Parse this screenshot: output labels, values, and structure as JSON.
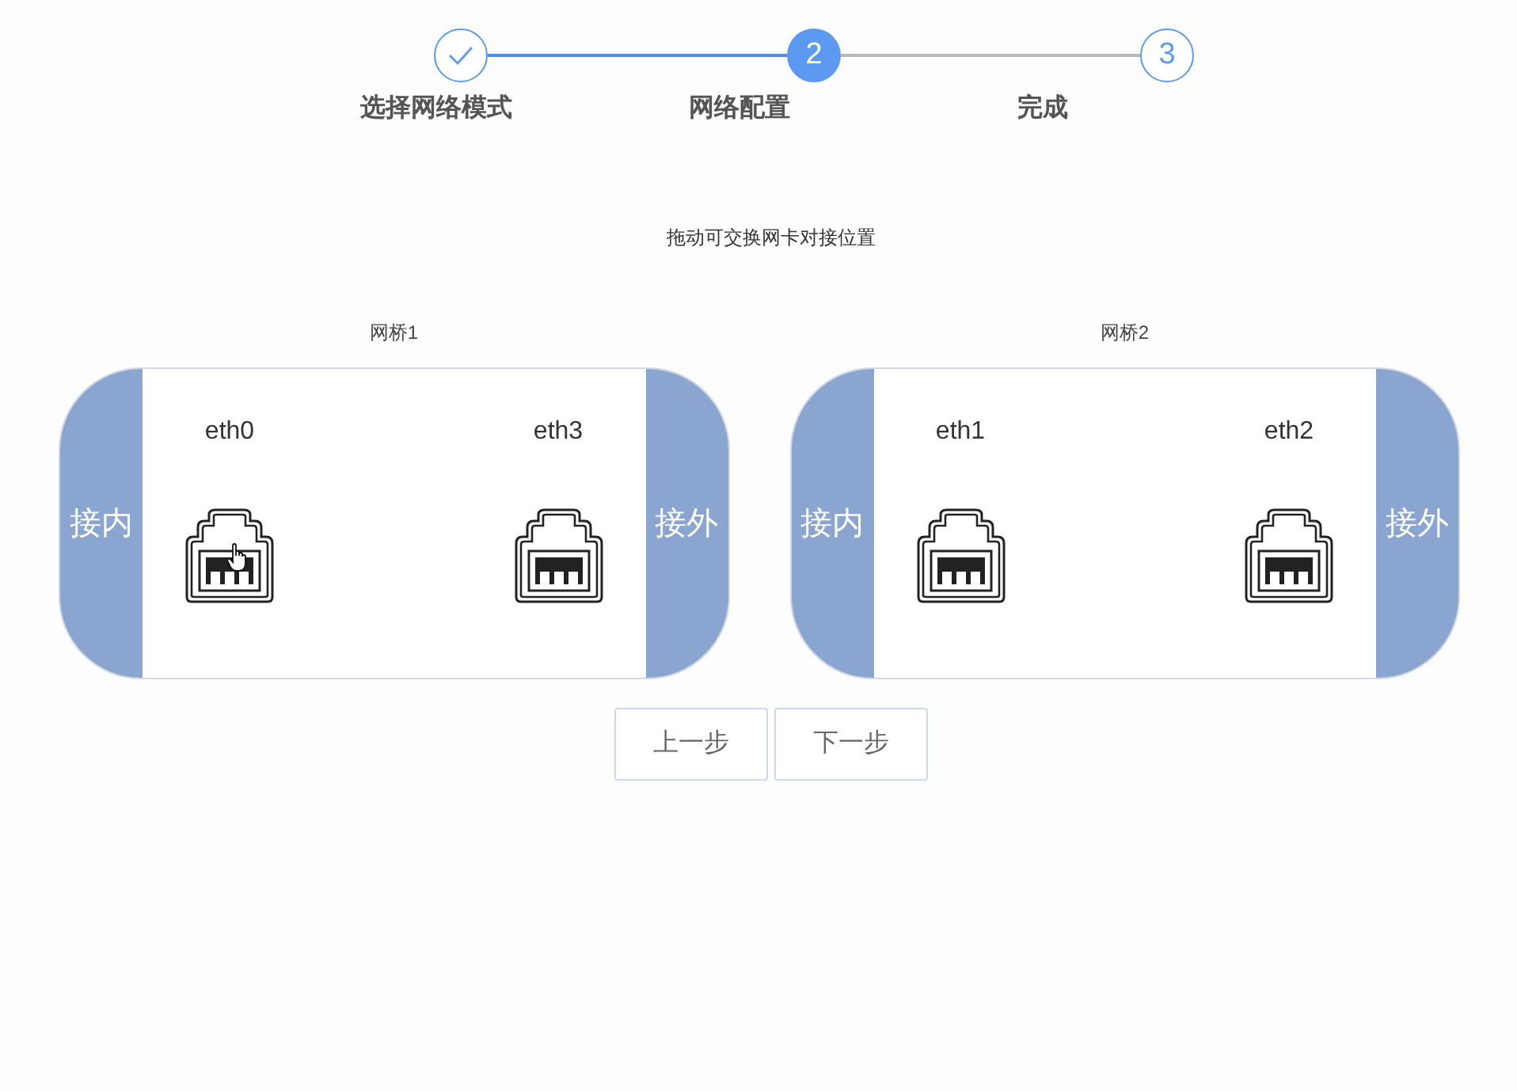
{
  "steps": [
    {
      "label": "选择网络模式",
      "completed": true,
      "selected": false
    },
    {
      "number": "2",
      "label": "网络配置",
      "completed": false,
      "selected": true
    },
    {
      "number": "3",
      "label": "完成",
      "completed": false,
      "selected": false
    }
  ],
  "hint": "拖动可交换网卡对接位置",
  "bridges": [
    {
      "title": "网桥1",
      "left_cap": "接内",
      "right_cap": "接外",
      "ports": [
        {
          "name": "eth0",
          "hovered": true
        },
        {
          "name": "eth3",
          "hovered": false
        }
      ]
    },
    {
      "title": "网桥2",
      "left_cap": "接内",
      "right_cap": "接外",
      "ports": [
        {
          "name": "eth1",
          "hovered": false
        },
        {
          "name": "eth2",
          "hovered": false
        }
      ]
    }
  ],
  "buttons": [
    "上一步",
    "下一步"
  ]
}
